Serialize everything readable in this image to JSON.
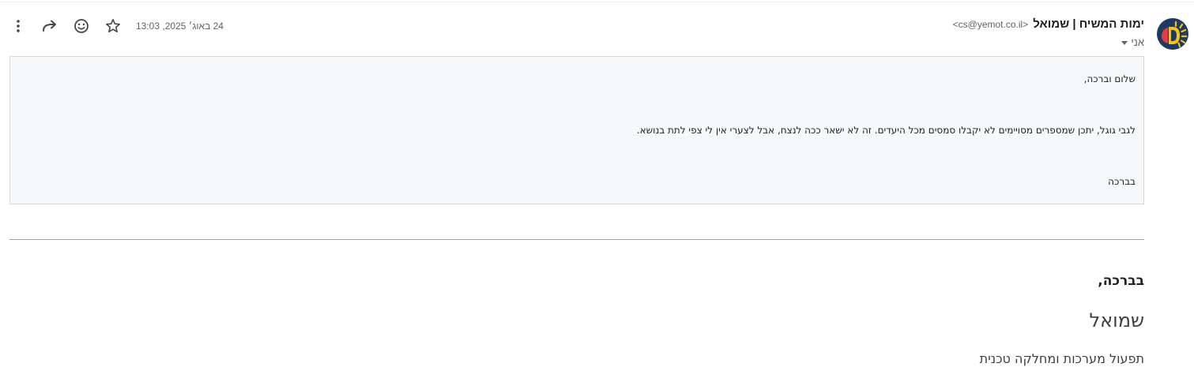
{
  "email": {
    "sender_name": "ימות המשיח | שמואל",
    "sender_email": "<cs@yemot.co.il>",
    "recipient_label": "אני",
    "date": "24 באוג׳ 2025, 13:03"
  },
  "toolbar": {
    "icons": [
      "more-vert-icon",
      "forward-icon",
      "emoji-icon",
      "star-icon"
    ]
  },
  "quoted_message": {
    "greeting": "שלום וברכה,",
    "body": "לגבי גוגל, יתכן שמספרים מסויימים לא יקבלו סמסים מכל היעדים. זה לא ישאר ככה לנצח, אבל לצערי אין לי צפי לתת בנושא.",
    "closing": "בברכה"
  },
  "signature": {
    "closing": "בברכה,",
    "name": "שמואל",
    "title": "תפעול מערכות ומחלקה טכנית"
  },
  "colors": {
    "quote_bg": "#f6f8fa",
    "quote_border": "#d5d8dc",
    "muted_text": "#5f6368"
  }
}
